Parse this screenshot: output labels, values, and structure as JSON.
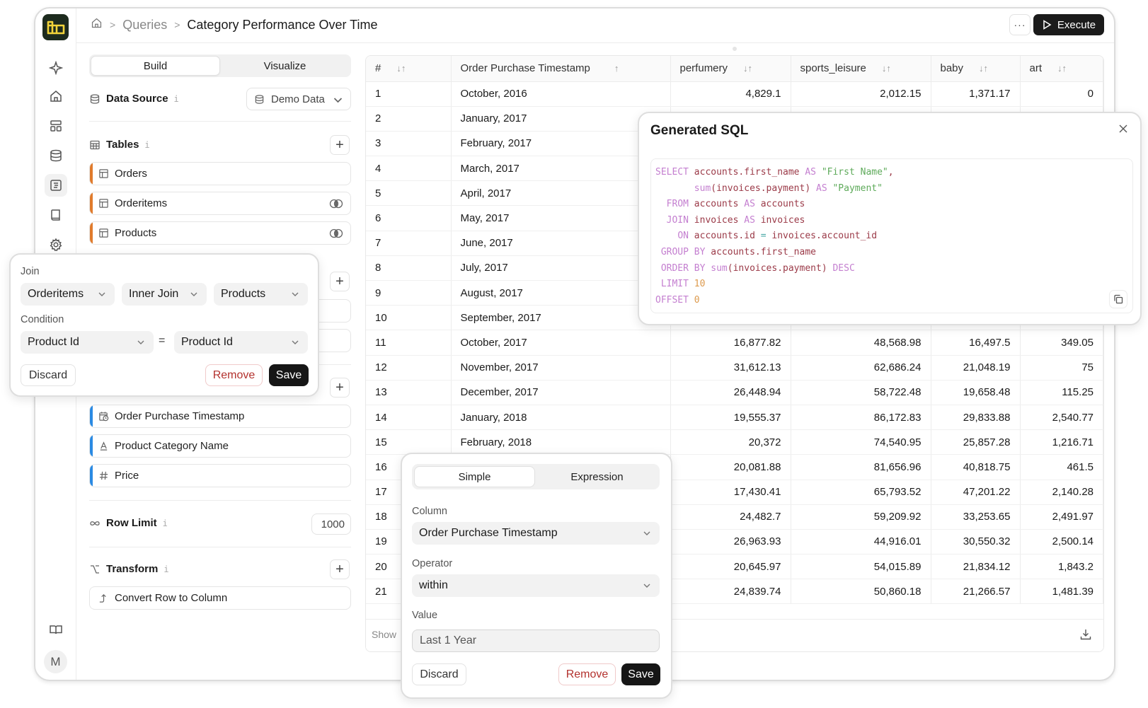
{
  "header": {
    "breadcrumbs": [
      "Queries",
      "Category Performance Over Time"
    ],
    "more_label": "···",
    "execute_label": "Execute"
  },
  "sidebar": {
    "items": [
      {
        "icon": "sparkle-icon"
      },
      {
        "icon": "home-icon"
      },
      {
        "icon": "dashboard-icon"
      },
      {
        "icon": "database-icon"
      },
      {
        "icon": "queries-icon",
        "active": true
      },
      {
        "icon": "notebook-icon"
      },
      {
        "icon": "settings-icon"
      }
    ],
    "bottom": [
      {
        "icon": "docs-icon"
      }
    ],
    "avatar_initial": "M"
  },
  "builder": {
    "tabs": [
      "Build",
      "Visualize"
    ],
    "active_tab": "Build",
    "data_source": {
      "label": "Data Source",
      "info": "i",
      "value": "Demo Data"
    },
    "tables": {
      "label": "Tables",
      "info": "i",
      "items": [
        {
          "name": "Orders",
          "joined": false
        },
        {
          "name": "Orderitems",
          "joined": true
        },
        {
          "name": "Products",
          "joined": true
        }
      ]
    },
    "columns": [
      {
        "name": "Order Purchase Timestamp",
        "type": "datetime"
      },
      {
        "name": "Product Category Name",
        "type": "text"
      },
      {
        "name": "Price",
        "type": "number"
      }
    ],
    "row_limit": {
      "label": "Row Limit",
      "info": "i",
      "value": "1000"
    },
    "transform": {
      "label": "Transform",
      "info": "i",
      "items": [
        "Convert Row to Column"
      ]
    }
  },
  "join_popover": {
    "join_label": "Join",
    "left_table": "Orderitems",
    "join_type": "Inner Join",
    "right_table": "Products",
    "condition_label": "Condition",
    "left_column": "Product Id",
    "operator": "=",
    "right_column": "Product Id",
    "discard": "Discard",
    "remove": "Remove",
    "save": "Save"
  },
  "filter_popover": {
    "tabs": [
      "Simple",
      "Expression"
    ],
    "active_tab": "Simple",
    "column_label": "Column",
    "column_value": "Order Purchase Timestamp",
    "operator_label": "Operator",
    "operator_value": "within",
    "value_label": "Value",
    "value_value": "Last 1 Year",
    "discard": "Discard",
    "remove": "Remove",
    "save": "Save"
  },
  "sql_popover": {
    "title": "Generated SQL",
    "lines": [
      [
        [
          "kw",
          "SELECT"
        ],
        [
          "t",
          " "
        ],
        [
          "id",
          "accounts.first_name"
        ],
        [
          "t",
          " "
        ],
        [
          "kw",
          "AS"
        ],
        [
          "t",
          " "
        ],
        [
          "str",
          "\"First Name\""
        ],
        [
          "id",
          ","
        ]
      ],
      [
        [
          "t",
          "       "
        ],
        [
          "kw",
          "sum"
        ],
        [
          "id",
          "(invoices.payment)"
        ],
        [
          "t",
          " "
        ],
        [
          "kw",
          "AS"
        ],
        [
          "t",
          " "
        ],
        [
          "str",
          "\"Payment\""
        ]
      ],
      [
        [
          "t",
          "  "
        ],
        [
          "kw",
          "FROM"
        ],
        [
          "t",
          " "
        ],
        [
          "id",
          "accounts"
        ],
        [
          "t",
          " "
        ],
        [
          "kw",
          "AS"
        ],
        [
          "t",
          " "
        ],
        [
          "id",
          "accounts"
        ]
      ],
      [
        [
          "t",
          "  "
        ],
        [
          "kw",
          "JOIN"
        ],
        [
          "t",
          " "
        ],
        [
          "id",
          "invoices"
        ],
        [
          "t",
          " "
        ],
        [
          "kw",
          "AS"
        ],
        [
          "t",
          " "
        ],
        [
          "id",
          "invoices"
        ]
      ],
      [
        [
          "t",
          "    "
        ],
        [
          "kw",
          "ON"
        ],
        [
          "t",
          " "
        ],
        [
          "id",
          "accounts.id"
        ],
        [
          "t",
          " "
        ],
        [
          "op",
          "="
        ],
        [
          "t",
          " "
        ],
        [
          "id",
          "invoices.account_id"
        ]
      ],
      [
        [
          "t",
          " "
        ],
        [
          "kw",
          "GROUP BY"
        ],
        [
          "t",
          " "
        ],
        [
          "id",
          "accounts.first_name"
        ]
      ],
      [
        [
          "t",
          " "
        ],
        [
          "kw",
          "ORDER BY"
        ],
        [
          "t",
          " "
        ],
        [
          "kw",
          "sum"
        ],
        [
          "id",
          "(invoices.payment)"
        ],
        [
          "t",
          " "
        ],
        [
          "kw",
          "DESC"
        ]
      ],
      [
        [
          "t",
          " "
        ],
        [
          "kw",
          "LIMIT"
        ],
        [
          "t",
          " "
        ],
        [
          "num",
          "10"
        ]
      ],
      [
        [
          "kw",
          "OFFSET"
        ],
        [
          "t",
          " "
        ],
        [
          "num",
          "0"
        ]
      ]
    ]
  },
  "results": {
    "columns": [
      "#",
      "Order Purchase Timestamp",
      "perfumery",
      "sports_leisure",
      "baby",
      "art"
    ],
    "sort_icons": [
      "sort-both",
      "sort-asc",
      "sort-both",
      "sort-both",
      "sort-both",
      "sort-both"
    ],
    "rows": [
      [
        "1",
        "October, 2016",
        "4,829.1",
        "2,012.15",
        "1,371.17",
        "0"
      ],
      [
        "2",
        "January, 2017",
        "",
        "",
        "",
        ""
      ],
      [
        "3",
        "February, 2017",
        "",
        "",
        "",
        ""
      ],
      [
        "4",
        "March, 2017",
        "",
        "",
        "",
        ""
      ],
      [
        "5",
        "April, 2017",
        "",
        "",
        "",
        ""
      ],
      [
        "6",
        "May, 2017",
        "",
        "",
        "",
        ""
      ],
      [
        "7",
        "June, 2017",
        "",
        "",
        "",
        ""
      ],
      [
        "8",
        "July, 2017",
        "",
        "",
        "",
        ""
      ],
      [
        "9",
        "August, 2017",
        "",
        "",
        "",
        ""
      ],
      [
        "10",
        "September, 2017",
        "",
        "",
        "",
        ""
      ],
      [
        "11",
        "October, 2017",
        "16,877.82",
        "48,568.98",
        "16,497.5",
        "349.05"
      ],
      [
        "12",
        "November, 2017",
        "31,612.13",
        "62,686.24",
        "21,048.19",
        "75"
      ],
      [
        "13",
        "December, 2017",
        "26,448.94",
        "58,722.48",
        "19,658.48",
        "115.25"
      ],
      [
        "14",
        "January, 2018",
        "19,555.37",
        "86,172.83",
        "29,833.88",
        "2,540.77"
      ],
      [
        "15",
        "February, 2018",
        "20,372",
        "74,540.95",
        "25,857.28",
        "1,216.71"
      ],
      [
        "16",
        "",
        "20,081.88",
        "81,656.96",
        "40,818.75",
        "461.5"
      ],
      [
        "17",
        "",
        "17,430.41",
        "65,793.52",
        "47,201.22",
        "2,140.28"
      ],
      [
        "18",
        "",
        "24,482.7",
        "59,209.92",
        "33,253.65",
        "2,491.97"
      ],
      [
        "19",
        "",
        "26,963.93",
        "44,916.01",
        "30,550.32",
        "2,500.14"
      ],
      [
        "20",
        "",
        "20,645.97",
        "54,015.89",
        "21,834.12",
        "1,843.2"
      ],
      [
        "21",
        "",
        "24,839.74",
        "50,860.18",
        "21,266.57",
        "1,481.39"
      ]
    ],
    "footer_text": "Show"
  }
}
